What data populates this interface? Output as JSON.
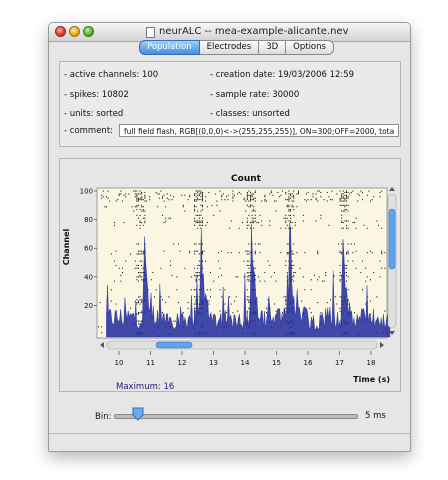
{
  "window": {
    "title": "neurALC -- mea-example-alicante.nev"
  },
  "tabs": [
    {
      "label": "Population",
      "active": true
    },
    {
      "label": "Electrodes",
      "active": false
    },
    {
      "label": "3D",
      "active": false
    },
    {
      "label": "Options",
      "active": false
    }
  ],
  "info": {
    "active_channels": "- active channels: 100",
    "creation_date": "- creation date: 19/03/2006 12:59",
    "spikes": "- spikes: 10802",
    "sample_rate": "- sample rate: 30000",
    "units": "- units: sorted",
    "classes": "- classes: unsorted",
    "comment_label": "- comment:",
    "comment_value": "full field flash, RGB[(0,0,0)<->(255,255,255)], ON=300;OFF=2000, tota"
  },
  "chart_data": {
    "type": "raster",
    "title": "Count",
    "ylabel": "Channel",
    "xlabel": "Time (s)",
    "xlim": [
      9.6,
      18.6
    ],
    "ylim": [
      0,
      100
    ],
    "x_ticks": [
      10,
      11,
      12,
      13,
      14,
      15,
      16,
      17,
      18
    ],
    "y_ticks": [
      20,
      40,
      60,
      80,
      100
    ],
    "flash_onsets_s": [
      10.8,
      12.6,
      14.2,
      15.4,
      17.1
    ],
    "count_maximum": 16
  },
  "count_max_label": "Maximum: 16",
  "bin": {
    "label": "Bin:",
    "value": "5 ms",
    "fraction": 0.1
  },
  "colors": {
    "raster_background": "#fbf6e2",
    "count_trace": "#1f2a9c",
    "spike": "#111111",
    "scroll_thumb": "#5fa3ee"
  }
}
